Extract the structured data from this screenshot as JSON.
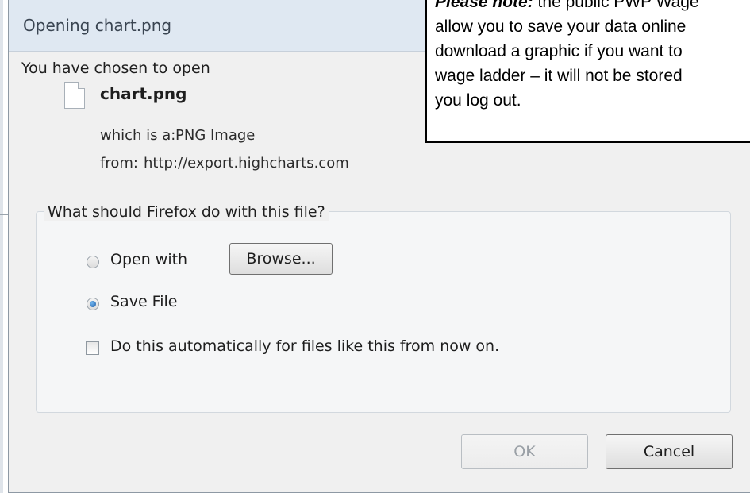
{
  "dialog": {
    "title": "Opening chart.png",
    "intro": "You have chosen to open",
    "file": {
      "name": "chart.png",
      "which_is_label": "which is a:",
      "which_is_value": "PNG Image",
      "from_label": "from:",
      "from_value": "http://export.highcharts.com"
    },
    "group": {
      "legend": "What should Firefox do with this file?",
      "open_with_label": "Open with",
      "browse_label": "Browse...",
      "save_file_label": "Save File",
      "selected": "save_file",
      "auto_label": "Do this automatically for files like this from now on.",
      "auto_checked": false
    },
    "buttons": {
      "ok": "OK",
      "cancel": "Cancel"
    }
  },
  "note": {
    "bold_prefix": "Please note:",
    "line1_rest": " the public PWP Wage",
    "line2": "allow you to save  your data online",
    "line3": "download a graphic if you want to",
    "line4": "wage ladder – it will not be stored",
    "line5": "you log out."
  }
}
